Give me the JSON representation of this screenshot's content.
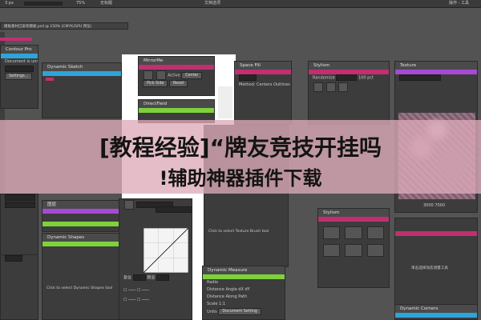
{
  "menubar": {
    "item1": "3 px",
    "item2": "75%",
    "item3": "无标题",
    "item4": "文档选项",
    "window_label": "操作 - 工具",
    "tab_title": "模板素材已安装模板.psd @ 150% (CMYK/GPU 预览)"
  },
  "panels": {
    "contour_pro": {
      "title": "Contour Pro",
      "line1": "Document is unmodified",
      "button": "Settings..."
    },
    "dynamic_sketch": {
      "title": "Dynamic Sketch"
    },
    "mirror_me": {
      "title": "MirrorMe",
      "active": "Active",
      "center": "Center",
      "pick_side": "Pick Side",
      "reset": "Reset"
    },
    "direct_field": {
      "title": "DirectField"
    },
    "space_fill": {
      "title": "Space Fill",
      "method": "Method:",
      "centers": "Centers",
      "outlines": "Outlines"
    },
    "stylism_top": {
      "title": "Stylism",
      "randomize": "Randomize",
      "value": "100",
      "unit": "pct"
    },
    "texture_panel": {
      "title": "Texture",
      "size_label": "3000 7000"
    },
    "stylism_bottom": {
      "title": "Stylism"
    },
    "dynamic_shapes": {
      "title": "Dynamic Shapes",
      "hint": "Click to select Dynamic Shapes tool"
    },
    "texture_brush": {
      "hint": "Click to select Texture Brush tool"
    },
    "dynamic_measure": {
      "title": "Dynamic Measure",
      "radio": "Radio",
      "distance": "Distance",
      "angle": "Angle",
      "dx": "dX",
      "dy": "dY",
      "path": "Distance Along Path",
      "scale": "Scale",
      "scale_val": "1:1",
      "units": "Units",
      "units_val": "Document Setting"
    },
    "curves": {
      "label_a": "复位",
      "label_b": "预设"
    },
    "right_bottom": {
      "hint": "单击选择动态测量工具"
    },
    "dynamic_corners": {
      "title": "Dynamic Corners"
    },
    "left_lower": {
      "label": "图层"
    }
  },
  "banner": {
    "line1": "[教程经验]“牌友竞技开挂吗",
    "line2": "!辅助神器插件下载"
  }
}
